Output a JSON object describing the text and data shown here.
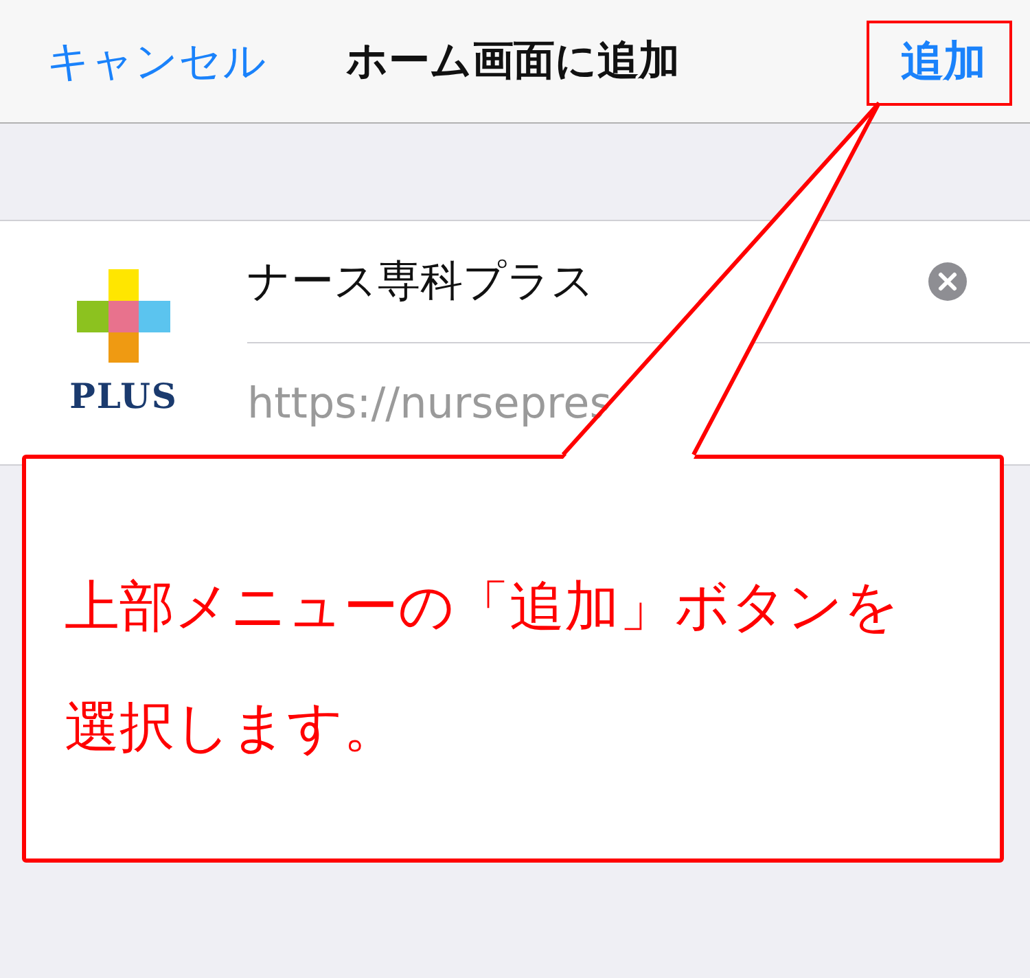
{
  "nav_bar": {
    "cancel": "キャンセル",
    "title": "ホーム画面に追加",
    "add": "追加",
    "add_highlighted": true
  },
  "bookmark": {
    "logo_text": "PLUS",
    "name": "ナース専科プラス",
    "url": "https://nursepres"
  },
  "callout": {
    "text": "上部メニューの「追加」ボタンを選択します。"
  }
}
